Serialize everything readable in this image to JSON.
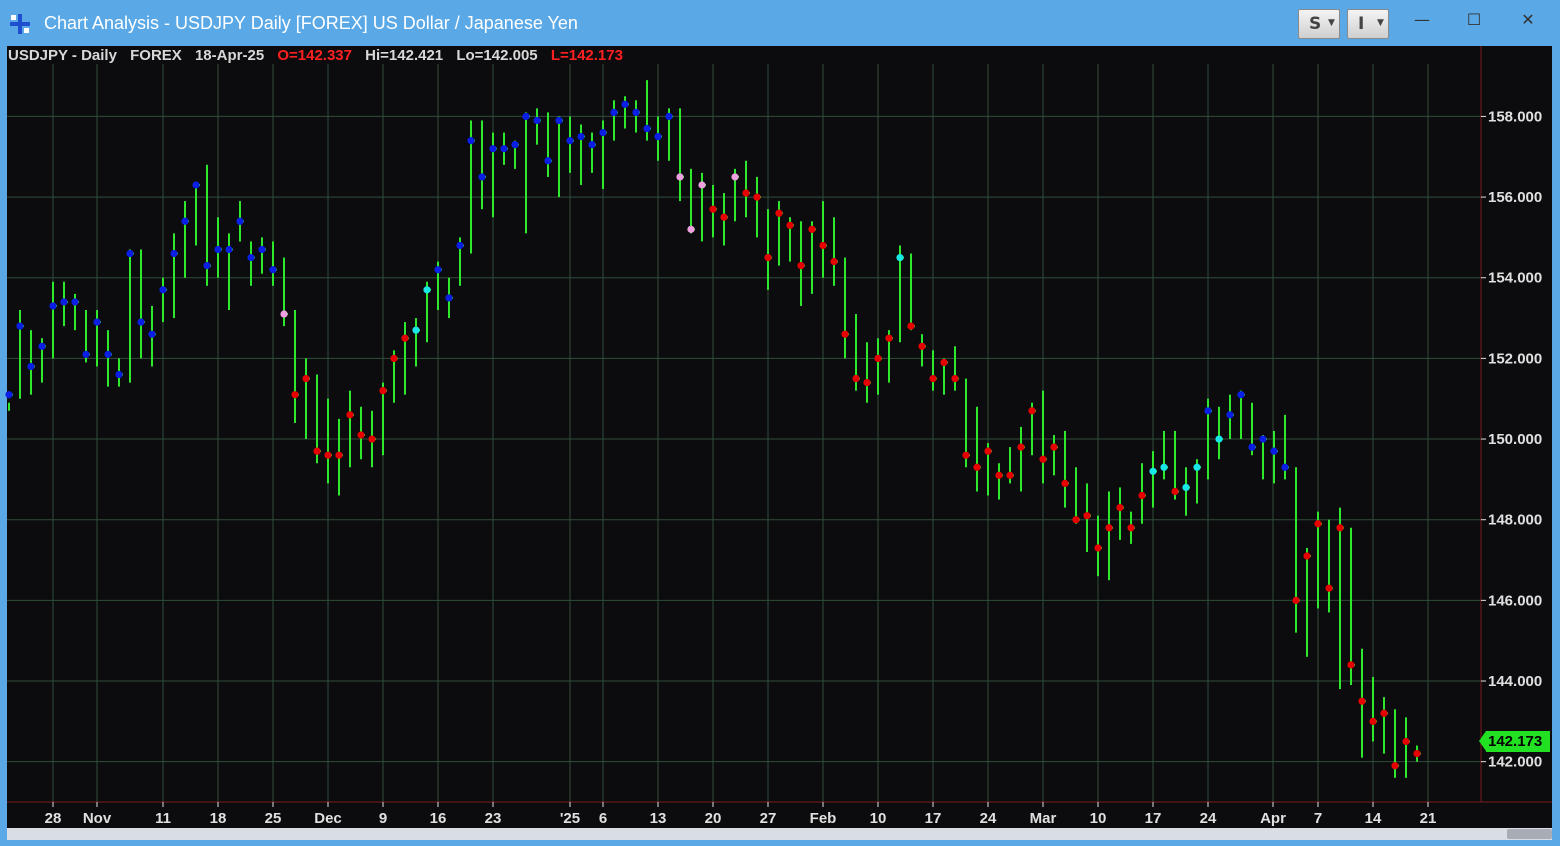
{
  "window": {
    "title": "Chart Analysis - USDJPY Daily [FOREX] US Dollar / Japanese Yen",
    "buttons": [
      {
        "label": "S",
        "icon": "caret-down-icon"
      },
      {
        "label": "I",
        "icon": "caret-down-icon"
      }
    ],
    "controls": {
      "minimize": "—",
      "maximize": "☐",
      "close": "✕"
    }
  },
  "info": {
    "symbol": "USDJPY - Daily",
    "exchange": "FOREX",
    "date": "18-Apr-25",
    "open": "O=142.337",
    "high": "Hi=142.421",
    "low": "Lo=142.005",
    "last": "L=142.173"
  },
  "last_price_label": "142.173",
  "colors": {
    "background": "#0c0c0e",
    "bar": "#2ee82e",
    "grid": "#2f4d3a",
    "up_strong": "#0a1ee6",
    "up_weak": "#19e6e6",
    "down_strong": "#e60000",
    "down_weak": "#f0a0e0",
    "axis_text": "#e0e0e0",
    "price_line": "#7a1c1c"
  },
  "chart_data": {
    "type": "bar",
    "title": "",
    "y_axis": {
      "min": 141.0,
      "max": 159.3,
      "ticks": [
        "158.000",
        "156.000",
        "154.000",
        "152.000",
        "150.000",
        "148.000",
        "146.000",
        "144.000",
        "142.000"
      ],
      "position": "right"
    },
    "x_labels": [
      "28",
      "Nov",
      "11",
      "18",
      "25",
      "Dec",
      "9",
      "16",
      "23",
      "'25",
      "6",
      "13",
      "20",
      "27",
      "Feb",
      "10",
      "17",
      "24",
      "Mar",
      "10",
      "17",
      "24",
      "Apr",
      "7",
      "14",
      "21"
    ],
    "grid": true,
    "series": [
      {
        "h": 150.9,
        "l": 150.7,
        "c": 151.1,
        "k": "b"
      },
      {
        "h": 153.2,
        "l": 151.0,
        "c": 152.8,
        "k": "b"
      },
      {
        "h": 152.7,
        "l": 151.1,
        "c": 151.8,
        "k": "b"
      },
      {
        "h": 152.5,
        "l": 151.4,
        "c": 152.3,
        "k": "b"
      },
      {
        "h": 153.9,
        "l": 152.0,
        "c": 153.3,
        "k": "b"
      },
      {
        "h": 153.9,
        "l": 152.8,
        "c": 153.4,
        "k": "b"
      },
      {
        "h": 153.6,
        "l": 152.7,
        "c": 153.4,
        "k": "b"
      },
      {
        "h": 153.2,
        "l": 151.9,
        "c": 152.1,
        "k": "b"
      },
      {
        "h": 153.2,
        "l": 151.8,
        "c": 152.9,
        "k": "b"
      },
      {
        "h": 152.7,
        "l": 151.3,
        "c": 152.1,
        "k": "b"
      },
      {
        "h": 152.0,
        "l": 151.3,
        "c": 151.6,
        "k": "b"
      },
      {
        "h": 154.7,
        "l": 151.4,
        "c": 154.6,
        "k": "b"
      },
      {
        "h": 154.7,
        "l": 152.0,
        "c": 152.9,
        "k": "b"
      },
      {
        "h": 153.3,
        "l": 151.8,
        "c": 152.6,
        "k": "b"
      },
      {
        "h": 154.0,
        "l": 152.9,
        "c": 153.7,
        "k": "b"
      },
      {
        "h": 155.1,
        "l": 153.0,
        "c": 154.6,
        "k": "b"
      },
      {
        "h": 155.9,
        "l": 154.0,
        "c": 155.4,
        "k": "b"
      },
      {
        "h": 156.3,
        "l": 154.8,
        "c": 156.3,
        "k": "b"
      },
      {
        "h": 156.8,
        "l": 153.8,
        "c": 154.3,
        "k": "b"
      },
      {
        "h": 155.5,
        "l": 154.0,
        "c": 154.7,
        "k": "b"
      },
      {
        "h": 155.1,
        "l": 153.2,
        "c": 154.7,
        "k": "b"
      },
      {
        "h": 155.9,
        "l": 154.9,
        "c": 155.4,
        "k": "b"
      },
      {
        "h": 154.9,
        "l": 153.8,
        "c": 154.5,
        "k": "b"
      },
      {
        "h": 155.0,
        "l": 154.1,
        "c": 154.7,
        "k": "b"
      },
      {
        "h": 154.9,
        "l": 153.8,
        "c": 154.2,
        "k": "b"
      },
      {
        "h": 154.5,
        "l": 152.8,
        "c": 153.1,
        "k": "p"
      },
      {
        "h": 153.2,
        "l": 150.4,
        "c": 151.1,
        "k": "r"
      },
      {
        "h": 152.0,
        "l": 150.0,
        "c": 151.5,
        "k": "r"
      },
      {
        "h": 151.6,
        "l": 149.4,
        "c": 149.7,
        "k": "r"
      },
      {
        "h": 151.0,
        "l": 148.9,
        "c": 149.6,
        "k": "r"
      },
      {
        "h": 150.5,
        "l": 148.6,
        "c": 149.6,
        "k": "r"
      },
      {
        "h": 151.2,
        "l": 149.3,
        "c": 150.6,
        "k": "r"
      },
      {
        "h": 150.8,
        "l": 149.5,
        "c": 150.1,
        "k": "r"
      },
      {
        "h": 150.7,
        "l": 149.3,
        "c": 150.0,
        "k": "r"
      },
      {
        "h": 151.4,
        "l": 149.6,
        "c": 151.2,
        "k": "r"
      },
      {
        "h": 152.2,
        "l": 150.9,
        "c": 152.0,
        "k": "r"
      },
      {
        "h": 152.9,
        "l": 151.1,
        "c": 152.5,
        "k": "r"
      },
      {
        "h": 153.0,
        "l": 151.8,
        "c": 152.7,
        "k": "c"
      },
      {
        "h": 153.9,
        "l": 152.4,
        "c": 153.7,
        "k": "c"
      },
      {
        "h": 154.4,
        "l": 153.2,
        "c": 154.2,
        "k": "b"
      },
      {
        "h": 154.0,
        "l": 153.0,
        "c": 153.5,
        "k": "b"
      },
      {
        "h": 155.0,
        "l": 153.8,
        "c": 154.8,
        "k": "b"
      },
      {
        "h": 157.9,
        "l": 154.6,
        "c": 157.4,
        "k": "b"
      },
      {
        "h": 157.9,
        "l": 155.7,
        "c": 156.5,
        "k": "b"
      },
      {
        "h": 157.6,
        "l": 155.5,
        "c": 157.2,
        "k": "b"
      },
      {
        "h": 157.6,
        "l": 156.8,
        "c": 157.2,
        "k": "b"
      },
      {
        "h": 157.4,
        "l": 156.7,
        "c": 157.3,
        "k": "b"
      },
      {
        "h": 158.1,
        "l": 155.1,
        "c": 158.0,
        "k": "b"
      },
      {
        "h": 158.2,
        "l": 157.3,
        "c": 157.9,
        "k": "b"
      },
      {
        "h": 158.1,
        "l": 156.5,
        "c": 156.9,
        "k": "b"
      },
      {
        "h": 158.0,
        "l": 156.0,
        "c": 157.9,
        "k": "b"
      },
      {
        "h": 158.0,
        "l": 156.6,
        "c": 157.4,
        "k": "b"
      },
      {
        "h": 157.8,
        "l": 156.3,
        "c": 157.5,
        "k": "b"
      },
      {
        "h": 157.6,
        "l": 156.6,
        "c": 157.3,
        "k": "b"
      },
      {
        "h": 157.9,
        "l": 156.2,
        "c": 157.6,
        "k": "b"
      },
      {
        "h": 158.4,
        "l": 157.4,
        "c": 158.1,
        "k": "b"
      },
      {
        "h": 158.5,
        "l": 157.7,
        "c": 158.3,
        "k": "b"
      },
      {
        "h": 158.4,
        "l": 157.6,
        "c": 158.1,
        "k": "b"
      },
      {
        "h": 158.9,
        "l": 157.4,
        "c": 157.7,
        "k": "b"
      },
      {
        "h": 158.0,
        "l": 156.9,
        "c": 157.5,
        "k": "b"
      },
      {
        "h": 158.2,
        "l": 156.9,
        "c": 158.0,
        "k": "b"
      },
      {
        "h": 158.2,
        "l": 155.9,
        "c": 156.5,
        "k": "p"
      },
      {
        "h": 156.7,
        "l": 155.1,
        "c": 155.2,
        "k": "p"
      },
      {
        "h": 156.6,
        "l": 154.9,
        "c": 156.3,
        "k": "p"
      },
      {
        "h": 156.3,
        "l": 155.0,
        "c": 155.7,
        "k": "r"
      },
      {
        "h": 156.1,
        "l": 154.8,
        "c": 155.5,
        "k": "r"
      },
      {
        "h": 156.7,
        "l": 155.4,
        "c": 156.5,
        "k": "p"
      },
      {
        "h": 156.9,
        "l": 155.5,
        "c": 156.1,
        "k": "r"
      },
      {
        "h": 156.5,
        "l": 155.0,
        "c": 156.0,
        "k": "r"
      },
      {
        "h": 155.7,
        "l": 153.7,
        "c": 154.5,
        "k": "r"
      },
      {
        "h": 155.9,
        "l": 154.3,
        "c": 155.6,
        "k": "r"
      },
      {
        "h": 155.5,
        "l": 154.4,
        "c": 155.3,
        "k": "r"
      },
      {
        "h": 155.4,
        "l": 153.3,
        "c": 154.3,
        "k": "r"
      },
      {
        "h": 155.4,
        "l": 153.6,
        "c": 155.2,
        "k": "r"
      },
      {
        "h": 155.9,
        "l": 154.0,
        "c": 154.8,
        "k": "r"
      },
      {
        "h": 155.5,
        "l": 153.8,
        "c": 154.4,
        "k": "r"
      },
      {
        "h": 154.5,
        "l": 152.0,
        "c": 152.6,
        "k": "r"
      },
      {
        "h": 153.1,
        "l": 151.2,
        "c": 151.5,
        "k": "r"
      },
      {
        "h": 152.4,
        "l": 150.9,
        "c": 151.4,
        "k": "r"
      },
      {
        "h": 152.5,
        "l": 151.1,
        "c": 152.0,
        "k": "r"
      },
      {
        "h": 152.7,
        "l": 151.4,
        "c": 152.5,
        "k": "r"
      },
      {
        "h": 154.8,
        "l": 152.4,
        "c": 154.5,
        "k": "c"
      },
      {
        "h": 154.6,
        "l": 152.7,
        "c": 152.8,
        "k": "r"
      },
      {
        "h": 152.6,
        "l": 151.8,
        "c": 152.3,
        "k": "r"
      },
      {
        "h": 152.2,
        "l": 151.2,
        "c": 151.5,
        "k": "r"
      },
      {
        "h": 152.0,
        "l": 151.1,
        "c": 151.9,
        "k": "r"
      },
      {
        "h": 152.3,
        "l": 151.2,
        "c": 151.5,
        "k": "r"
      },
      {
        "h": 151.5,
        "l": 149.3,
        "c": 149.6,
        "k": "r"
      },
      {
        "h": 150.8,
        "l": 148.7,
        "c": 149.3,
        "k": "r"
      },
      {
        "h": 149.9,
        "l": 148.6,
        "c": 149.7,
        "k": "r"
      },
      {
        "h": 149.4,
        "l": 148.5,
        "c": 149.1,
        "k": "r"
      },
      {
        "h": 149.8,
        "l": 148.9,
        "c": 149.1,
        "k": "r"
      },
      {
        "h": 150.3,
        "l": 148.7,
        "c": 149.8,
        "k": "r"
      },
      {
        "h": 150.9,
        "l": 149.6,
        "c": 150.7,
        "k": "r"
      },
      {
        "h": 151.2,
        "l": 148.9,
        "c": 149.5,
        "k": "r"
      },
      {
        "h": 150.1,
        "l": 149.1,
        "c": 149.8,
        "k": "r"
      },
      {
        "h": 150.2,
        "l": 148.3,
        "c": 148.9,
        "k": "r"
      },
      {
        "h": 149.3,
        "l": 147.9,
        "c": 148.0,
        "k": "r"
      },
      {
        "h": 148.9,
        "l": 147.2,
        "c": 148.1,
        "k": "r"
      },
      {
        "h": 148.1,
        "l": 146.6,
        "c": 147.3,
        "k": "r"
      },
      {
        "h": 148.7,
        "l": 146.5,
        "c": 147.8,
        "k": "r"
      },
      {
        "h": 148.8,
        "l": 147.5,
        "c": 148.3,
        "k": "r"
      },
      {
        "h": 148.2,
        "l": 147.4,
        "c": 147.8,
        "k": "r"
      },
      {
        "h": 149.4,
        "l": 147.9,
        "c": 148.6,
        "k": "r"
      },
      {
        "h": 149.7,
        "l": 148.3,
        "c": 149.2,
        "k": "c"
      },
      {
        "h": 150.2,
        "l": 149.0,
        "c": 149.3,
        "k": "c"
      },
      {
        "h": 150.2,
        "l": 148.5,
        "c": 148.7,
        "k": "r"
      },
      {
        "h": 149.3,
        "l": 148.1,
        "c": 148.8,
        "k": "c"
      },
      {
        "h": 149.5,
        "l": 148.4,
        "c": 149.3,
        "k": "c"
      },
      {
        "h": 151.0,
        "l": 149.0,
        "c": 150.7,
        "k": "b"
      },
      {
        "h": 150.8,
        "l": 149.5,
        "c": 150.0,
        "k": "c"
      },
      {
        "h": 151.1,
        "l": 150.0,
        "c": 150.6,
        "k": "b"
      },
      {
        "h": 151.2,
        "l": 150.0,
        "c": 151.1,
        "k": "b"
      },
      {
        "h": 150.9,
        "l": 149.6,
        "c": 149.8,
        "k": "b"
      },
      {
        "h": 150.1,
        "l": 149.0,
        "c": 150.0,
        "k": "b"
      },
      {
        "h": 150.2,
        "l": 148.9,
        "c": 149.7,
        "k": "b"
      },
      {
        "h": 150.6,
        "l": 149.0,
        "c": 149.3,
        "k": "b"
      },
      {
        "h": 149.3,
        "l": 145.2,
        "c": 146.0,
        "k": "r"
      },
      {
        "h": 147.3,
        "l": 144.6,
        "c": 147.1,
        "k": "r"
      },
      {
        "h": 148.2,
        "l": 145.8,
        "c": 147.9,
        "k": "r"
      },
      {
        "h": 148.0,
        "l": 145.7,
        "c": 146.3,
        "k": "r"
      },
      {
        "h": 148.3,
        "l": 143.8,
        "c": 147.8,
        "k": "r"
      },
      {
        "h": 147.8,
        "l": 143.9,
        "c": 144.4,
        "k": "r"
      },
      {
        "h": 144.8,
        "l": 142.1,
        "c": 143.5,
        "k": "r"
      },
      {
        "h": 144.1,
        "l": 142.5,
        "c": 143.0,
        "k": "r"
      },
      {
        "h": 143.6,
        "l": 142.2,
        "c": 143.2,
        "k": "r"
      },
      {
        "h": 143.3,
        "l": 141.6,
        "c": 141.9,
        "k": "r"
      },
      {
        "h": 143.1,
        "l": 141.6,
        "c": 142.5,
        "k": "r"
      },
      {
        "h": 142.4,
        "l": 142.0,
        "c": 142.2,
        "k": "r"
      }
    ]
  }
}
